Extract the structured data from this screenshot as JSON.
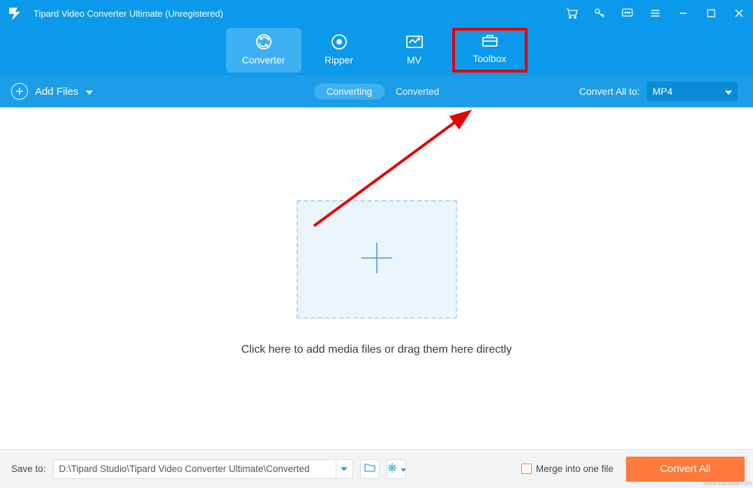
{
  "app": {
    "title": "Tipard Video Converter Ultimate (Unregistered)"
  },
  "nav": {
    "converter": "Converter",
    "ripper": "Ripper",
    "mv": "MV",
    "toolbox": "Toolbox"
  },
  "subbar": {
    "add_files": "Add Files",
    "converting": "Converting",
    "converted": "Converted",
    "convert_all_to": "Convert All to:",
    "selected_format": "MP4"
  },
  "canvas": {
    "instruction": "Click here to add media files or drag them here directly"
  },
  "bottom": {
    "save_to_label": "Save to:",
    "save_path": "D:\\Tipard Studio\\Tipard Video Converter Ultimate\\Converted",
    "merge_label": "Merge into one file",
    "convert_button": "Convert All"
  },
  "watermark": "www.xiazaiba.com"
}
